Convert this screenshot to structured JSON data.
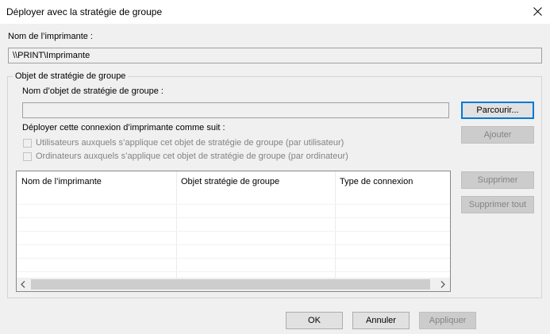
{
  "window": {
    "title": "Déployer avec la stratégie de groupe",
    "close_icon": "close-icon"
  },
  "printer_name": {
    "label": "Nom de l’imprimante :",
    "value": "\\\\PRINT\\Imprimante"
  },
  "gpo_group": {
    "legend": "Objet de stratégie de groupe",
    "name_label": "Nom d’objet de stratégie de groupe :",
    "name_value": "",
    "browse_label": "Parcourir...",
    "add_label": "Ajouter",
    "deploy_label": "Déployer cette connexion d’imprimante comme suit :",
    "per_user_label": "Utilisateurs auxquels s’applique cet objet de stratégie de groupe (par utilisateur)",
    "per_user_checked": false,
    "per_machine_label": "Ordinateurs auxquels s’applique cet objet de stratégie de groupe (par ordinateur)",
    "per_machine_checked": false,
    "list": {
      "columns": [
        "Nom de l’imprimante",
        "Objet stratégie de groupe",
        "Type de connexion"
      ],
      "rows": []
    },
    "remove_label": "Supprimer",
    "remove_all_label": "Supprimer tout"
  },
  "footer": {
    "ok_label": "OK",
    "cancel_label": "Annuler",
    "apply_label": "Appliquer"
  }
}
